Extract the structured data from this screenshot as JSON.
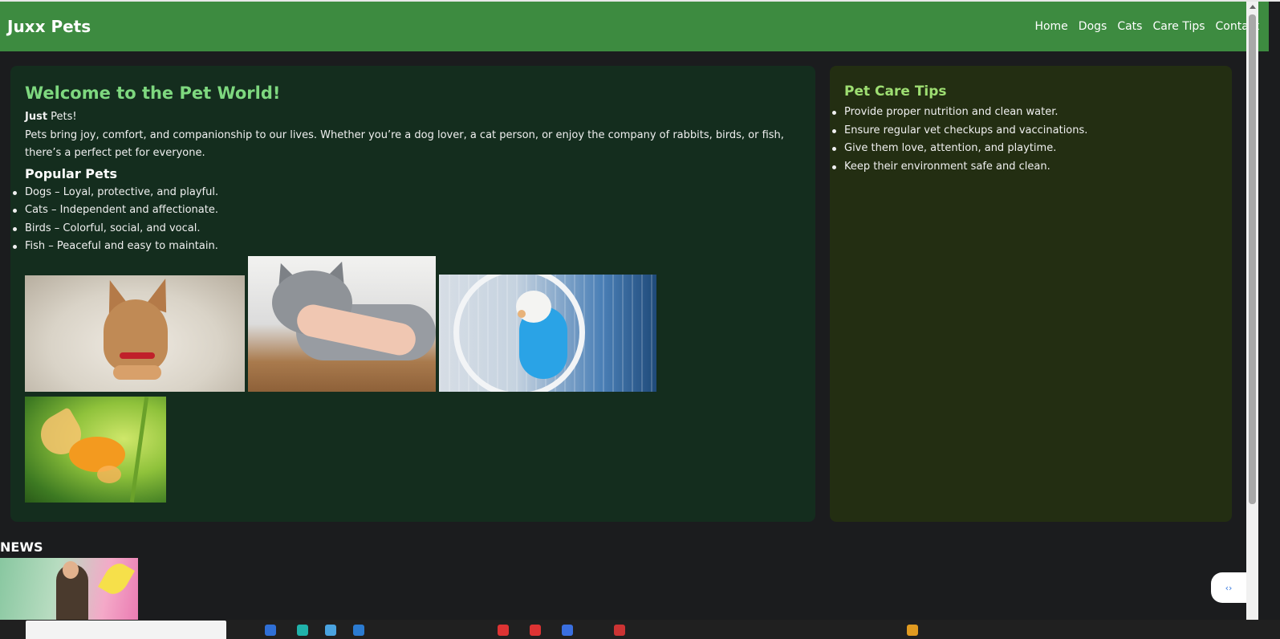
{
  "header": {
    "brand": "Juxx Pets",
    "nav": [
      "Home",
      "Dogs",
      "Cats",
      "Care Tips",
      "Contact"
    ]
  },
  "main": {
    "title": "Welcome to the Pet World!",
    "tagline_bold": "Just",
    "tagline_rest": " Pets!",
    "intro": "Pets bring joy, comfort, and companionship to our lives. Whether you’re a dog lover, a cat person, or enjoy the company of rabbits, birds, or fish, there’s a perfect pet for everyone.",
    "popular_heading": "Popular Pets",
    "popular": [
      "Dogs – Loyal, protective, and playful.",
      "Cats – Independent and affectionate.",
      "Birds – Colorful, social, and vocal.",
      "Fish – Peaceful and easy to maintain."
    ]
  },
  "sidebar": {
    "title": "Pet Care Tips",
    "tips": [
      "Provide proper nutrition and clean water.",
      "Ensure regular vet checkups and vaccinations.",
      "Give them love, attention, and playtime.",
      "Keep their environment safe and clean."
    ]
  },
  "news": {
    "heading": "NEWS"
  },
  "colors": {
    "navbar": "#3d8b40",
    "page_bg": "#1b1c1e",
    "main_card": "#142d1e",
    "side_card": "#232e12",
    "title_green": "#7ed87f",
    "side_title_green": "#9ede72"
  },
  "icons": {
    "float_widget": "expand-icon",
    "scroll": "scroll-up-icon"
  }
}
